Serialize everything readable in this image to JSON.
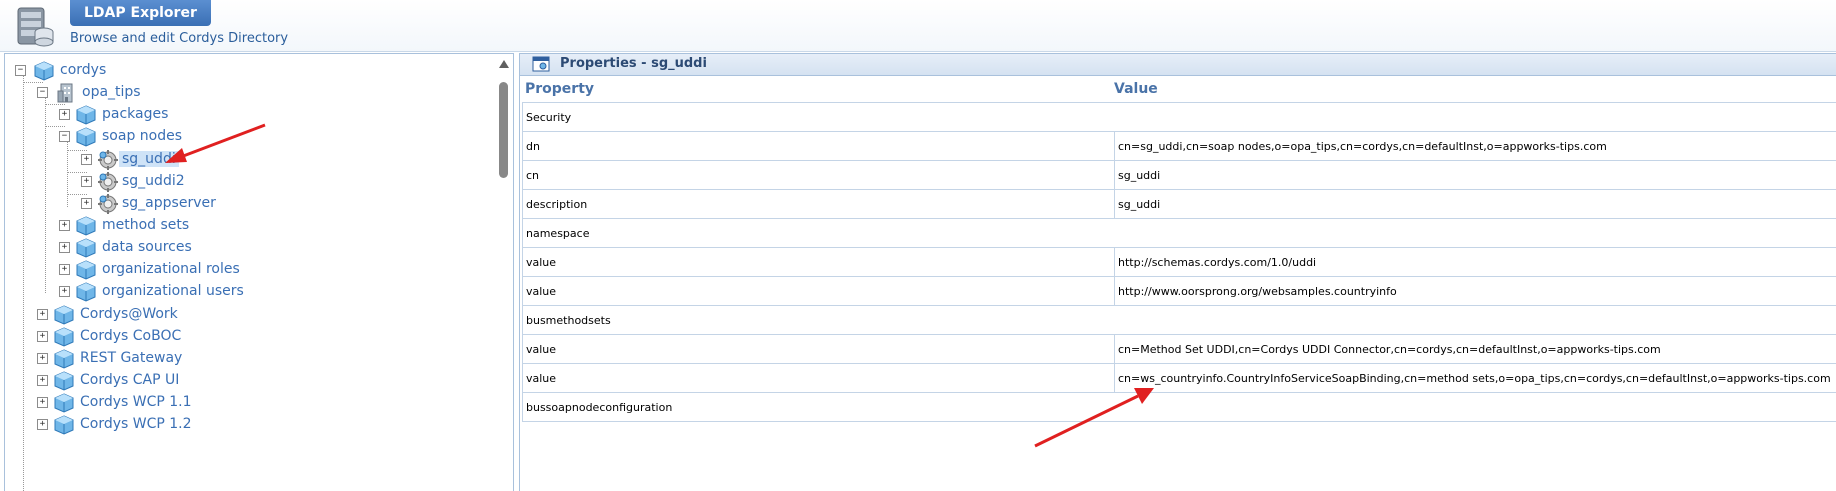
{
  "app": {
    "title": "LDAP Explorer",
    "subtitle": "Browse and edit Cordys Directory"
  },
  "tree": {
    "nodes": [
      {
        "label": "cordys",
        "expander": "−"
      },
      {
        "label": "opa_tips",
        "expander": "−"
      },
      {
        "label": "packages",
        "expander": "+"
      },
      {
        "label": "soap nodes",
        "expander": "−"
      },
      {
        "label": "sg_uddi",
        "expander": "+"
      },
      {
        "label": "sg_uddi2",
        "expander": "+"
      },
      {
        "label": "sg_appserver",
        "expander": "+"
      },
      {
        "label": "method sets",
        "expander": "+"
      },
      {
        "label": "data sources",
        "expander": "+"
      },
      {
        "label": "organizational roles",
        "expander": "+"
      },
      {
        "label": "organizational users",
        "expander": "+"
      },
      {
        "label": "Cordys@Work",
        "expander": "+"
      },
      {
        "label": "Cordys CoBOC",
        "expander": "+"
      },
      {
        "label": "REST Gateway",
        "expander": "+"
      },
      {
        "label": "Cordys CAP UI",
        "expander": "+"
      },
      {
        "label": "Cordys WCP 1.1",
        "expander": "+"
      },
      {
        "label": "Cordys WCP 1.2",
        "expander": "+"
      }
    ]
  },
  "properties": {
    "title": "Properties - sg_uddi",
    "columns": {
      "property": "Property",
      "value": "Value"
    },
    "rows": [
      {
        "property": "Security",
        "value": ""
      },
      {
        "property": "dn",
        "value": "cn=sg_uddi,cn=soap nodes,o=opa_tips,cn=cordys,cn=defaultInst,o=appworks-tips.com"
      },
      {
        "property": "cn",
        "value": "sg_uddi"
      },
      {
        "property": "description",
        "value": "sg_uddi"
      },
      {
        "property": "namespace",
        "value": ""
      },
      {
        "property": "value",
        "value": "http://schemas.cordys.com/1.0/uddi"
      },
      {
        "property": "value",
        "value": "http://www.oorsprong.org/websamples.countryinfo"
      },
      {
        "property": "busmethodsets",
        "value": ""
      },
      {
        "property": "value",
        "value": "cn=Method Set UDDI,cn=Cordys UDDI Connector,cn=cordys,cn=defaultInst,o=appworks-tips.com"
      },
      {
        "property": "value",
        "value": "cn=ws_countryinfo.CountryInfoServiceSoapBinding,cn=method sets,o=opa_tips,cn=cordys,cn=defaultInst,o=appworks-tips.com"
      },
      {
        "property": "bussoapnodeconfiguration",
        "value": ""
      }
    ]
  },
  "colors": {
    "accent": "#3a6fb4",
    "arrow": "#e02020"
  }
}
